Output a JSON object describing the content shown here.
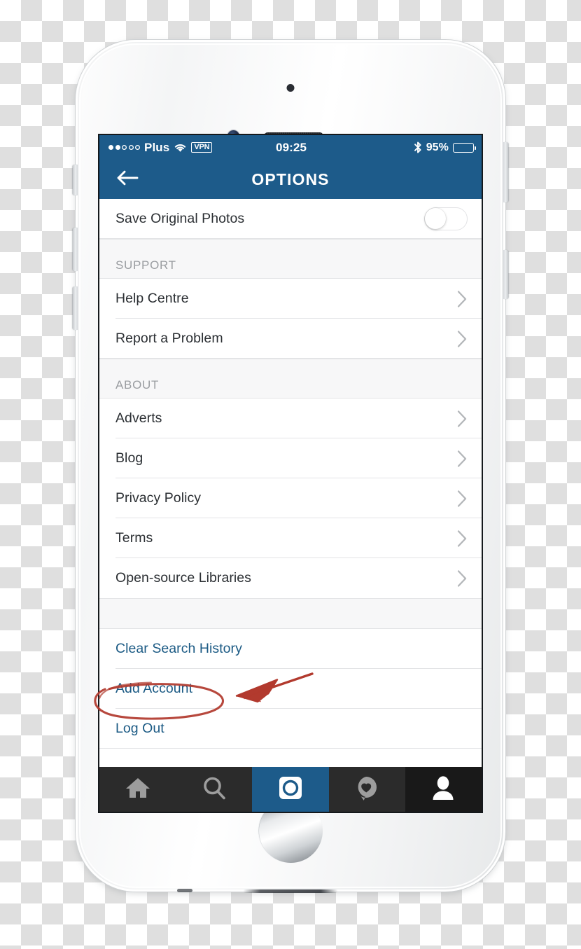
{
  "status_bar": {
    "signal_dots_filled": 2,
    "signal_dots_total": 5,
    "carrier": "Plus",
    "wifi_icon": "wifi-icon",
    "vpn_badge": "VPN",
    "time": "09:25",
    "bluetooth_icon": "bluetooth-icon",
    "battery_percent": "95%",
    "battery_icon": "battery-full-icon"
  },
  "nav_bar": {
    "back_icon": "arrow-left-icon",
    "title": "OPTIONS"
  },
  "colors": {
    "nav_blue": "#1d5b8a",
    "link_blue": "#1b5a84",
    "section_bg": "#f7f7f8",
    "separator": "#e3e4e6",
    "row_text": "#2b2f33",
    "section_text": "#9a9da1",
    "tab_bar_bg": "#2b2b2b",
    "annotation_red": "#c0392b"
  },
  "settings": {
    "top_rows": [
      {
        "label": "Save Original Photos",
        "control": "toggle",
        "toggle_on": false
      }
    ],
    "sections": [
      {
        "header": "SUPPORT",
        "rows": [
          {
            "label": "Help Centre",
            "accessory": "chevron-right-icon"
          },
          {
            "label": "Report a Problem",
            "accessory": "chevron-right-icon"
          }
        ]
      },
      {
        "header": "ABOUT",
        "rows": [
          {
            "label": "Adverts",
            "accessory": "chevron-right-icon"
          },
          {
            "label": "Blog",
            "accessory": "chevron-right-icon"
          },
          {
            "label": "Privacy Policy",
            "accessory": "chevron-right-icon"
          },
          {
            "label": "Terms",
            "accessory": "chevron-right-icon"
          },
          {
            "label": "Open-source Libraries",
            "accessory": "chevron-right-icon"
          }
        ]
      }
    ],
    "action_rows": [
      {
        "label": "Clear Search History"
      },
      {
        "label": "Add Account",
        "annotated": true
      },
      {
        "label": "Log Out"
      }
    ]
  },
  "tab_bar": {
    "tabs": [
      {
        "name": "home",
        "icon": "home-icon",
        "state": "inactive"
      },
      {
        "name": "search",
        "icon": "search-icon",
        "state": "inactive"
      },
      {
        "name": "camera",
        "icon": "camera-icon",
        "state": "highlighted"
      },
      {
        "name": "activity",
        "icon": "heart-bubble-icon",
        "state": "inactive"
      },
      {
        "name": "profile",
        "icon": "person-icon",
        "state": "active"
      }
    ]
  },
  "annotations": {
    "ellipse_target": "Add Account",
    "arrow": "hand-drawn-arrow-pointing-left"
  }
}
